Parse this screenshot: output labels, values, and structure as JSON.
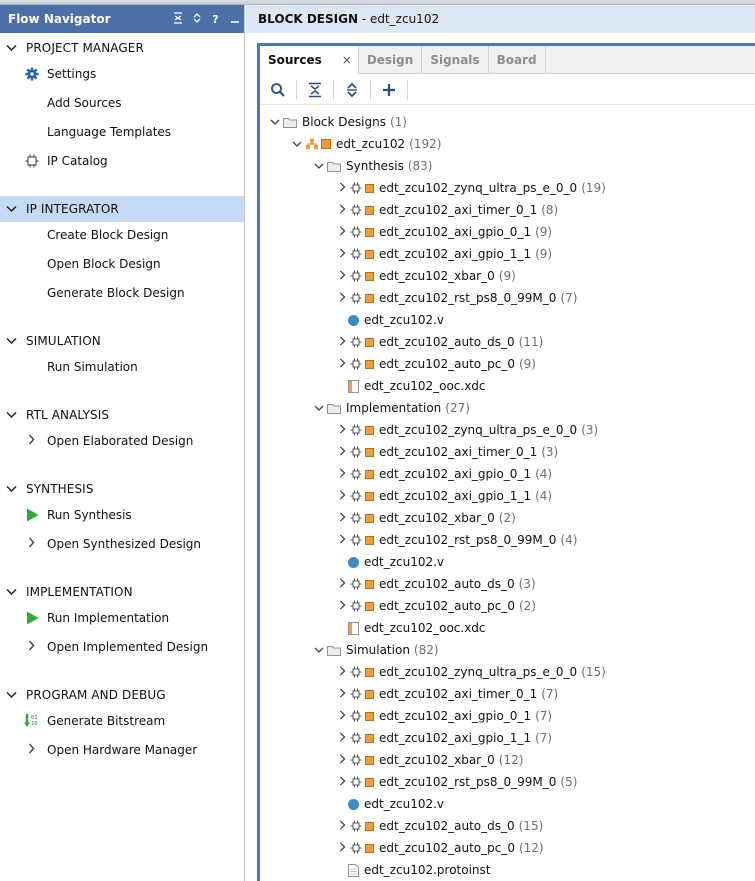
{
  "flow_navigator": {
    "title": "Flow Navigator",
    "header_icons": [
      "collapse-all-icon",
      "expand-icon",
      "help-icon",
      "minimize-icon"
    ],
    "sections": [
      {
        "title": "PROJECT MANAGER",
        "items": [
          {
            "label": "Settings",
            "icon": "gear-icon"
          },
          {
            "label": "Add Sources",
            "icon": ""
          },
          {
            "label": "Language Templates",
            "icon": ""
          },
          {
            "label": "IP Catalog",
            "icon": "ip-plug-icon"
          }
        ]
      },
      {
        "title": "IP INTEGRATOR",
        "selected": true,
        "items": [
          {
            "label": "Create Block Design"
          },
          {
            "label": "Open Block Design"
          },
          {
            "label": "Generate Block Design"
          }
        ]
      },
      {
        "title": "SIMULATION",
        "items": [
          {
            "label": "Run Simulation"
          }
        ]
      },
      {
        "title": "RTL ANALYSIS",
        "items": [
          {
            "label": "Open Elaborated Design",
            "expandable": true
          }
        ]
      },
      {
        "title": "SYNTHESIS",
        "items": [
          {
            "label": "Run Synthesis",
            "icon": "run-triangle-icon"
          },
          {
            "label": "Open Synthesized Design",
            "expandable": true
          }
        ]
      },
      {
        "title": "IMPLEMENTATION",
        "items": [
          {
            "label": "Run Implementation",
            "icon": "run-triangle-icon"
          },
          {
            "label": "Open Implemented Design",
            "expandable": true
          }
        ]
      },
      {
        "title": "PROGRAM AND DEBUG",
        "items": [
          {
            "label": "Generate Bitstream",
            "icon": "bitstream-icon"
          },
          {
            "label": "Open Hardware Manager",
            "expandable": true
          }
        ]
      }
    ]
  },
  "block_design": {
    "title_prefix": "BLOCK DESIGN",
    "title_suffix": " - edt_zcu102",
    "tabs": [
      {
        "label": "Sources",
        "active": true,
        "close": "×"
      },
      {
        "label": "Design"
      },
      {
        "label": "Signals"
      },
      {
        "label": "Board"
      }
    ],
    "toolbar": [
      "search-icon",
      "collapse-all-icon",
      "expand-all-icon",
      "add-icon"
    ]
  },
  "tree": {
    "root": {
      "label": "Block Designs",
      "count": "(1)"
    },
    "design": {
      "label": "edt_zcu102",
      "count": "(192)"
    },
    "groups": [
      {
        "label": "Synthesis",
        "count": "(83)",
        "children": [
          {
            "label": "edt_zcu102_zynq_ultra_ps_e_0_0",
            "count": "(19)",
            "kind": "ip"
          },
          {
            "label": "edt_zcu102_axi_timer_0_1",
            "count": "(8)",
            "kind": "ip"
          },
          {
            "label": "edt_zcu102_axi_gpio_0_1",
            "count": "(9)",
            "kind": "ip"
          },
          {
            "label": "edt_zcu102_axi_gpio_1_1",
            "count": "(9)",
            "kind": "ip"
          },
          {
            "label": "edt_zcu102_xbar_0",
            "count": "(9)",
            "kind": "ip"
          },
          {
            "label": "edt_zcu102_rst_ps8_0_99M_0",
            "count": "(7)",
            "kind": "ip"
          },
          {
            "label": "edt_zcu102.v",
            "count": "",
            "kind": "verilog"
          },
          {
            "label": "edt_zcu102_auto_ds_0",
            "count": "(11)",
            "kind": "ip"
          },
          {
            "label": "edt_zcu102_auto_pc_0",
            "count": "(9)",
            "kind": "ip"
          },
          {
            "label": "edt_zcu102_ooc.xdc",
            "count": "",
            "kind": "xdc"
          }
        ]
      },
      {
        "label": "Implementation",
        "count": "(27)",
        "children": [
          {
            "label": "edt_zcu102_zynq_ultra_ps_e_0_0",
            "count": "(3)",
            "kind": "ip"
          },
          {
            "label": "edt_zcu102_axi_timer_0_1",
            "count": "(3)",
            "kind": "ip"
          },
          {
            "label": "edt_zcu102_axi_gpio_0_1",
            "count": "(4)",
            "kind": "ip"
          },
          {
            "label": "edt_zcu102_axi_gpio_1_1",
            "count": "(4)",
            "kind": "ip"
          },
          {
            "label": "edt_zcu102_xbar_0",
            "count": "(2)",
            "kind": "ip"
          },
          {
            "label": "edt_zcu102_rst_ps8_0_99M_0",
            "count": "(4)",
            "kind": "ip"
          },
          {
            "label": "edt_zcu102.v",
            "count": "",
            "kind": "verilog"
          },
          {
            "label": "edt_zcu102_auto_ds_0",
            "count": "(3)",
            "kind": "ip"
          },
          {
            "label": "edt_zcu102_auto_pc_0",
            "count": "(2)",
            "kind": "ip"
          },
          {
            "label": "edt_zcu102_ooc.xdc",
            "count": "",
            "kind": "xdc"
          }
        ]
      },
      {
        "label": "Simulation",
        "count": "(82)",
        "children": [
          {
            "label": "edt_zcu102_zynq_ultra_ps_e_0_0",
            "count": "(15)",
            "kind": "ip"
          },
          {
            "label": "edt_zcu102_axi_timer_0_1",
            "count": "(7)",
            "kind": "ip"
          },
          {
            "label": "edt_zcu102_axi_gpio_0_1",
            "count": "(7)",
            "kind": "ip"
          },
          {
            "label": "edt_zcu102_axi_gpio_1_1",
            "count": "(7)",
            "kind": "ip"
          },
          {
            "label": "edt_zcu102_xbar_0",
            "count": "(12)",
            "kind": "ip"
          },
          {
            "label": "edt_zcu102_rst_ps8_0_99M_0",
            "count": "(5)",
            "kind": "ip"
          },
          {
            "label": "edt_zcu102.v",
            "count": "",
            "kind": "verilog"
          },
          {
            "label": "edt_zcu102_auto_ds_0",
            "count": "(15)",
            "kind": "ip"
          },
          {
            "label": "edt_zcu102_auto_pc_0",
            "count": "(12)",
            "kind": "ip"
          },
          {
            "label": "edt_zcu102.protoinst",
            "count": "",
            "kind": "file"
          }
        ]
      }
    ]
  },
  "colors": {
    "header_blue": "#4c6fa7",
    "selected_row": "#c5daf5",
    "frame_blue": "#4c78b8",
    "run_green": "#2ea836",
    "ip_orange": "#f29b3a",
    "verilog_blue": "#3b8cc5"
  }
}
